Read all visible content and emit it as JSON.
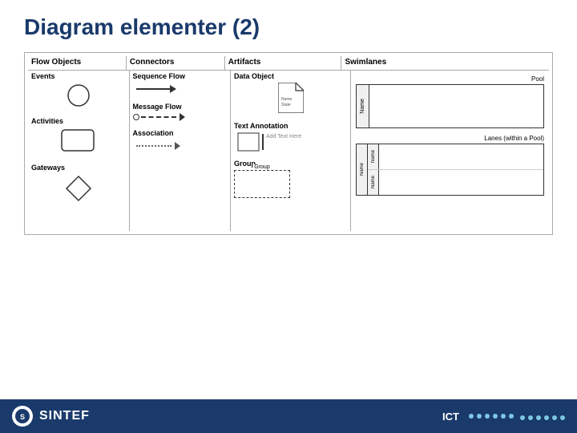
{
  "title": "Diagram elementer (2)",
  "columns": {
    "flow_objects": "Flow Objects",
    "connectors": "Connectors",
    "artifacts": "Artifacts",
    "swimlanes": "Swimlanes"
  },
  "flow_objects": {
    "events": {
      "label": "Events"
    },
    "activities": {
      "label": "Activities"
    },
    "gateways": {
      "label": "Gateways"
    }
  },
  "connectors": {
    "sequence_flow": {
      "label": "Sequence Flow"
    },
    "message_flow": {
      "label": "Message Flow"
    },
    "association": {
      "label": "Association"
    }
  },
  "artifacts": {
    "data_object": {
      "label": "Data Object"
    },
    "text_annotation": {
      "label": "Text Annotation",
      "placeholder": "Add Text Here"
    },
    "group": {
      "label": "Group"
    }
  },
  "swimlanes": {
    "pool": {
      "label": "Pool",
      "name": "Name"
    },
    "lanes": {
      "label": "Lanes (within a Pool)",
      "name_outer": "Name",
      "name_inner1": "Name",
      "name_inner2": "Name"
    }
  },
  "footer": {
    "logo_text": "S",
    "company": "SINTEF",
    "ict": "ICT"
  }
}
